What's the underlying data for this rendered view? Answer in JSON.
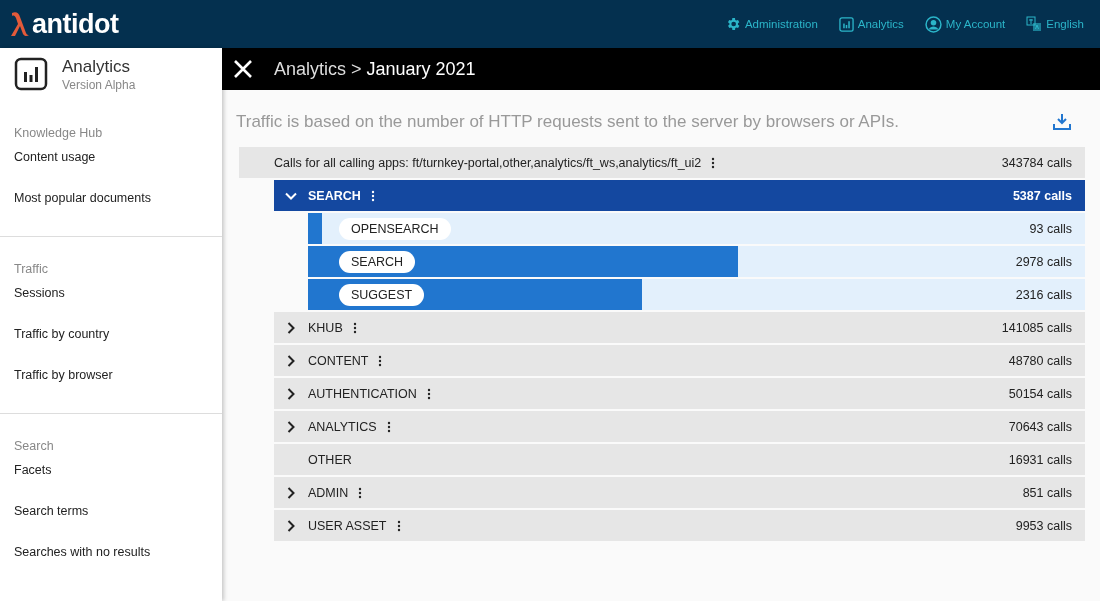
{
  "header": {
    "logo": "antidot",
    "nav": [
      {
        "kind": "gear",
        "label": "Administration"
      },
      {
        "kind": "chart",
        "label": "Analytics"
      },
      {
        "kind": "user",
        "label": "My Account"
      },
      {
        "kind": "lang",
        "label": "English"
      }
    ]
  },
  "sidebar": {
    "app_title": "Analytics",
    "app_subtitle": "Version Alpha",
    "sections": [
      {
        "heading": "Knowledge Hub",
        "items": [
          "Content usage",
          "Most popular documents"
        ]
      },
      {
        "heading": "Traffic",
        "items": [
          "Sessions",
          "Traffic by country",
          "Traffic by browser"
        ]
      },
      {
        "heading": "Search",
        "items": [
          "Facets",
          "Search terms",
          "Searches with no results"
        ]
      }
    ]
  },
  "breadcrumb": {
    "parent": "Analytics",
    "separator": ">",
    "current": "January 2021"
  },
  "description": "Traffic is based on the number of HTTP requests sent to the server by browsers or APIs.",
  "total": {
    "label": "Calls for all calling apps: ft/turnkey-portal,other,analytics/ft_ws,analytics/ft_ui2",
    "count": "343784 calls"
  },
  "groups": [
    {
      "kind": "expandable",
      "name": "SEARCH",
      "count": "5387 calls",
      "expanded": true,
      "children": [
        {
          "name": "OPENSEARCH",
          "count": "93 calls",
          "level": 0.018
        },
        {
          "name": "SEARCH",
          "count": "2978 calls",
          "level": 0.553
        },
        {
          "name": "SUGGEST",
          "count": "2316 calls",
          "level": 0.43
        }
      ]
    },
    {
      "kind": "expandable",
      "name": "KHUB",
      "count": "141085 calls",
      "expanded": false
    },
    {
      "kind": "expandable",
      "name": "CONTENT",
      "count": "48780 calls",
      "expanded": false
    },
    {
      "kind": "expandable",
      "name": "AUTHENTICATION",
      "count": "50154 calls",
      "expanded": false
    },
    {
      "kind": "expandable",
      "name": "ANALYTICS",
      "count": "70643 calls",
      "expanded": false
    },
    {
      "kind": "plain",
      "name": "OTHER",
      "count": "16931 calls"
    },
    {
      "kind": "expandable",
      "name": "ADMIN",
      "count": "851 calls",
      "expanded": false
    },
    {
      "kind": "expandable",
      "name": "USER ASSET",
      "count": "9953 calls",
      "expanded": false
    }
  ]
}
